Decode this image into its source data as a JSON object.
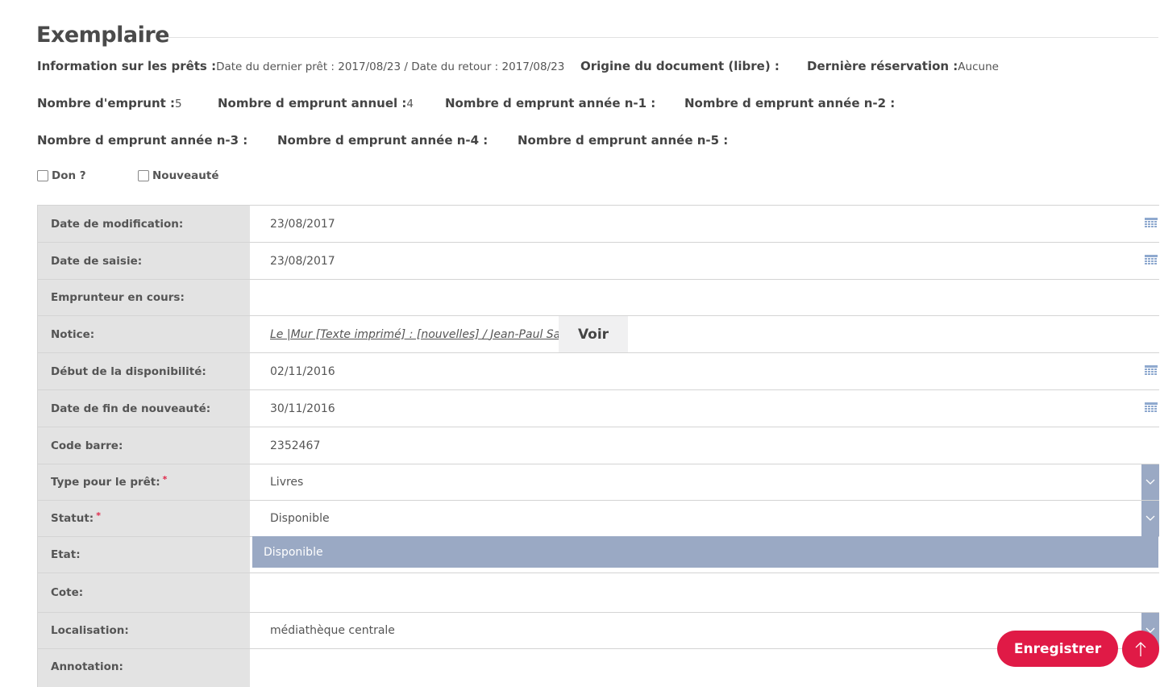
{
  "section": {
    "title": "Exemplaire"
  },
  "info": {
    "prets_label": "Information sur les prêts :",
    "prets_value": "Date du dernier prêt : 2017/08/23 / Date du retour : 2017/08/23",
    "origine_label": "Origine du document (libre) :",
    "derniere_resa_label": "Dernière réservation :",
    "derniere_resa_value": "Aucune",
    "nb_emprunt_label": "Nombre d'emprunt :",
    "nb_emprunt_value": "5",
    "nb_annuel_label": "Nombre d emprunt annuel :",
    "nb_annuel_value": "4",
    "n1_label": "Nombre d emprunt année n-1 :",
    "n2_label": "Nombre d emprunt année n-2 :",
    "n3_label": "Nombre d emprunt année n-3 :",
    "n4_label": "Nombre d emprunt année n-4 :",
    "n5_label": "Nombre d emprunt année n-5 :"
  },
  "checks": {
    "don_label": "Don ?",
    "nouveaute_label": "Nouveauté"
  },
  "form": {
    "date_modification": {
      "label": "Date de modification:",
      "value": "23/08/2017"
    },
    "date_saisie": {
      "label": "Date de saisie:",
      "value": "23/08/2017"
    },
    "emprunteur": {
      "label": "Emprunteur en cours:",
      "value": ""
    },
    "notice": {
      "label": "Notice:",
      "value": "Le |Mur [Texte imprimé] : [nouvelles] / Jean-Paul Sartre",
      "button": "Voir"
    },
    "debut_dispo": {
      "label": "Début de la disponibilité:",
      "value": "02/11/2016"
    },
    "fin_nouveaute": {
      "label": "Date de fin de nouveauté:",
      "value": "30/11/2016"
    },
    "code_barre": {
      "label": "Code barre:",
      "value": "2352467"
    },
    "type_pret": {
      "label": "Type pour le prêt:",
      "value": "Livres"
    },
    "statut": {
      "label": "Statut:",
      "value": "Disponible"
    },
    "etat": {
      "label": "Etat:"
    },
    "cote": {
      "label": "Cote:"
    },
    "localisation": {
      "label": "Localisation:",
      "value": "médiathèque centrale"
    },
    "annotation": {
      "label": "Annotation:"
    },
    "required_mark": "*"
  },
  "dropdown": {
    "option": "Disponible"
  },
  "actions": {
    "save_label": "Enregistrer"
  },
  "colors": {
    "accent": "#e01a46",
    "label_bg": "#e3e3e3",
    "dropdown_bg": "#9aa9c4"
  }
}
